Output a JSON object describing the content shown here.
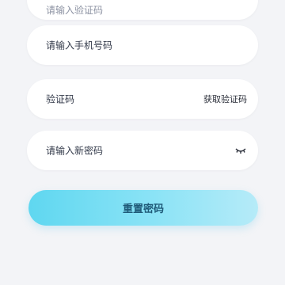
{
  "form": {
    "top_field_placeholder": "请输入验证码",
    "phone_placeholder": "请输入手机号码",
    "code_placeholder": "验证码",
    "get_code_label": "获取验证码",
    "password_placeholder": "请输入新密码",
    "submit_label": "重置密码"
  },
  "colors": {
    "background": "#f3f4f7",
    "field": "#ffffff",
    "button_start": "#5fd7f0",
    "button_end": "#b6ebf8"
  },
  "icons": {
    "password_toggle": "eye-closed-icon"
  }
}
